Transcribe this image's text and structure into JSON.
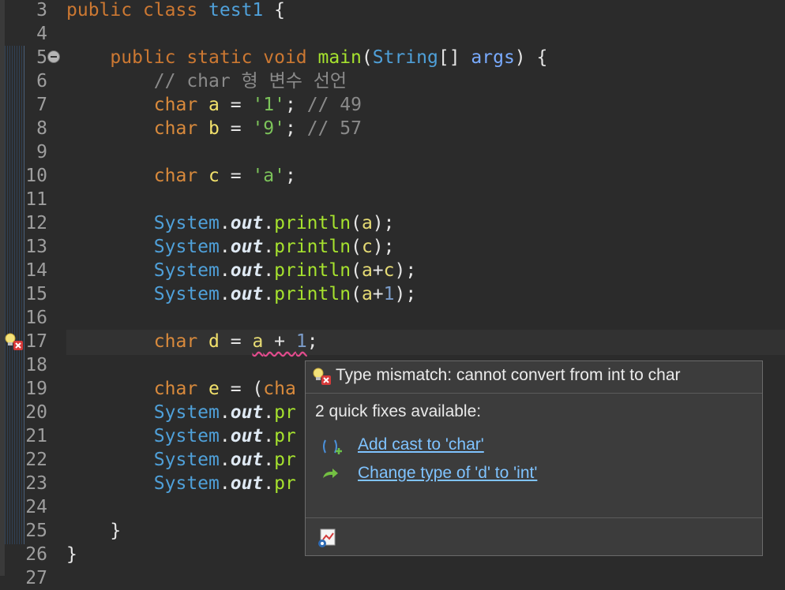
{
  "editor": {
    "lines": [
      {
        "num": "3",
        "tokens": [
          [
            "kw",
            "public "
          ],
          [
            "kw",
            "class "
          ],
          [
            "cls",
            "test1 "
          ],
          [
            "plain",
            "{"
          ]
        ]
      },
      {
        "num": "4",
        "tokens": []
      },
      {
        "num": "5",
        "tokens": [
          [
            "plain",
            "    "
          ],
          [
            "kw",
            "public "
          ],
          [
            "kw",
            "static "
          ],
          [
            "kw",
            "void "
          ],
          [
            "fn",
            "main"
          ],
          [
            "plain",
            "("
          ],
          [
            "cls",
            "String"
          ],
          [
            "plain",
            "[] "
          ],
          [
            "param",
            "args"
          ],
          [
            "plain",
            ") {"
          ]
        ]
      },
      {
        "num": "6",
        "tokens": [
          [
            "plain",
            "        "
          ],
          [
            "cmt",
            "// char 형 변수 선언"
          ]
        ]
      },
      {
        "num": "7",
        "tokens": [
          [
            "plain",
            "        "
          ],
          [
            "kw2",
            "char "
          ],
          [
            "var2",
            "a"
          ],
          [
            "plain",
            " = "
          ],
          [
            "str",
            "'1'"
          ],
          [
            "plain",
            "; "
          ],
          [
            "cmt",
            "// 49"
          ]
        ]
      },
      {
        "num": "8",
        "tokens": [
          [
            "plain",
            "        "
          ],
          [
            "kw2",
            "char "
          ],
          [
            "var2",
            "b"
          ],
          [
            "plain",
            " = "
          ],
          [
            "str",
            "'9'"
          ],
          [
            "plain",
            "; "
          ],
          [
            "cmt",
            "// 57"
          ]
        ]
      },
      {
        "num": "9",
        "tokens": []
      },
      {
        "num": "10",
        "tokens": [
          [
            "plain",
            "        "
          ],
          [
            "kw2",
            "char "
          ],
          [
            "var2",
            "c"
          ],
          [
            "plain",
            " = "
          ],
          [
            "str",
            "'a'"
          ],
          [
            "plain",
            ";"
          ]
        ]
      },
      {
        "num": "11",
        "tokens": []
      },
      {
        "num": "12",
        "tokens": [
          [
            "plain",
            "        "
          ],
          [
            "cls",
            "System"
          ],
          [
            "plain",
            "."
          ],
          [
            "fld",
            "out"
          ],
          [
            "plain",
            "."
          ],
          [
            "fn",
            "println"
          ],
          [
            "plain",
            "("
          ],
          [
            "var",
            "a"
          ],
          [
            "plain",
            ");"
          ]
        ]
      },
      {
        "num": "13",
        "tokens": [
          [
            "plain",
            "        "
          ],
          [
            "cls",
            "System"
          ],
          [
            "plain",
            "."
          ],
          [
            "fld",
            "out"
          ],
          [
            "plain",
            "."
          ],
          [
            "fn",
            "println"
          ],
          [
            "plain",
            "("
          ],
          [
            "var",
            "c"
          ],
          [
            "plain",
            ");"
          ]
        ]
      },
      {
        "num": "14",
        "tokens": [
          [
            "plain",
            "        "
          ],
          [
            "cls",
            "System"
          ],
          [
            "plain",
            "."
          ],
          [
            "fld",
            "out"
          ],
          [
            "plain",
            "."
          ],
          [
            "fn",
            "println"
          ],
          [
            "plain",
            "("
          ],
          [
            "var",
            "a"
          ],
          [
            "plain",
            "+"
          ],
          [
            "var",
            "c"
          ],
          [
            "plain",
            ");"
          ]
        ]
      },
      {
        "num": "15",
        "tokens": [
          [
            "plain",
            "        "
          ],
          [
            "cls",
            "System"
          ],
          [
            "plain",
            "."
          ],
          [
            "fld",
            "out"
          ],
          [
            "plain",
            "."
          ],
          [
            "fn",
            "println"
          ],
          [
            "plain",
            "("
          ],
          [
            "var",
            "a"
          ],
          [
            "plain",
            "+"
          ],
          [
            "num",
            "1"
          ],
          [
            "plain",
            ");"
          ]
        ]
      },
      {
        "num": "16",
        "tokens": []
      },
      {
        "num": "17",
        "tokens": [
          [
            "plain",
            "        "
          ],
          [
            "kw2",
            "char "
          ],
          [
            "var2",
            "d"
          ],
          [
            "plain",
            " = "
          ],
          [
            "var err",
            "a"
          ],
          [
            "plain err",
            " + "
          ],
          [
            "num err",
            "1"
          ],
          [
            "plain",
            ";"
          ]
        ]
      },
      {
        "num": "18",
        "tokens": []
      },
      {
        "num": "19",
        "tokens": [
          [
            "plain",
            "        "
          ],
          [
            "kw2",
            "char "
          ],
          [
            "var2",
            "e"
          ],
          [
            "plain",
            " = ("
          ],
          [
            "kw2",
            "cha"
          ]
        ]
      },
      {
        "num": "20",
        "tokens": [
          [
            "plain",
            "        "
          ],
          [
            "cls",
            "System"
          ],
          [
            "plain",
            "."
          ],
          [
            "fld",
            "out"
          ],
          [
            "plain",
            "."
          ],
          [
            "fn",
            "pr"
          ]
        ]
      },
      {
        "num": "21",
        "tokens": [
          [
            "plain",
            "        "
          ],
          [
            "cls",
            "System"
          ],
          [
            "plain",
            "."
          ],
          [
            "fld",
            "out"
          ],
          [
            "plain",
            "."
          ],
          [
            "fn",
            "pr"
          ]
        ]
      },
      {
        "num": "22",
        "tokens": [
          [
            "plain",
            "        "
          ],
          [
            "cls",
            "System"
          ],
          [
            "plain",
            "."
          ],
          [
            "fld",
            "out"
          ],
          [
            "plain",
            "."
          ],
          [
            "fn",
            "pr"
          ]
        ]
      },
      {
        "num": "23",
        "tokens": [
          [
            "plain",
            "        "
          ],
          [
            "cls",
            "System"
          ],
          [
            "plain",
            "."
          ],
          [
            "fld",
            "out"
          ],
          [
            "plain",
            "."
          ],
          [
            "fn",
            "pr"
          ]
        ]
      },
      {
        "num": "24",
        "tokens": []
      },
      {
        "num": "25",
        "tokens": [
          [
            "plain",
            "    }"
          ]
        ]
      },
      {
        "num": "26",
        "tokens": [
          [
            "plain",
            "}"
          ]
        ]
      },
      {
        "num": "27",
        "tokens": []
      }
    ]
  },
  "quickfix": {
    "title": "Type mismatch: cannot convert from int to char",
    "count_text": "2 quick fixes available:",
    "fixes": [
      {
        "label": "Add cast to 'char'",
        "icon": "add-cast-icon"
      },
      {
        "label": "Change type of 'd' to 'int'",
        "icon": "change-type-icon"
      }
    ]
  },
  "icons": {
    "gutter_error": "lightbulb-error-icon",
    "fold": "fold-collapse-icon",
    "config": "configure-problem-severity-icon"
  },
  "colors": {
    "background": "#2b2b2b",
    "keyword": "#cc7832",
    "type": "#4fa0d9",
    "method": "#a6e22e",
    "string": "#7cc35a",
    "comment": "#8a8a8a",
    "link": "#7fc3ff",
    "error_underline": "#e14b8c"
  }
}
